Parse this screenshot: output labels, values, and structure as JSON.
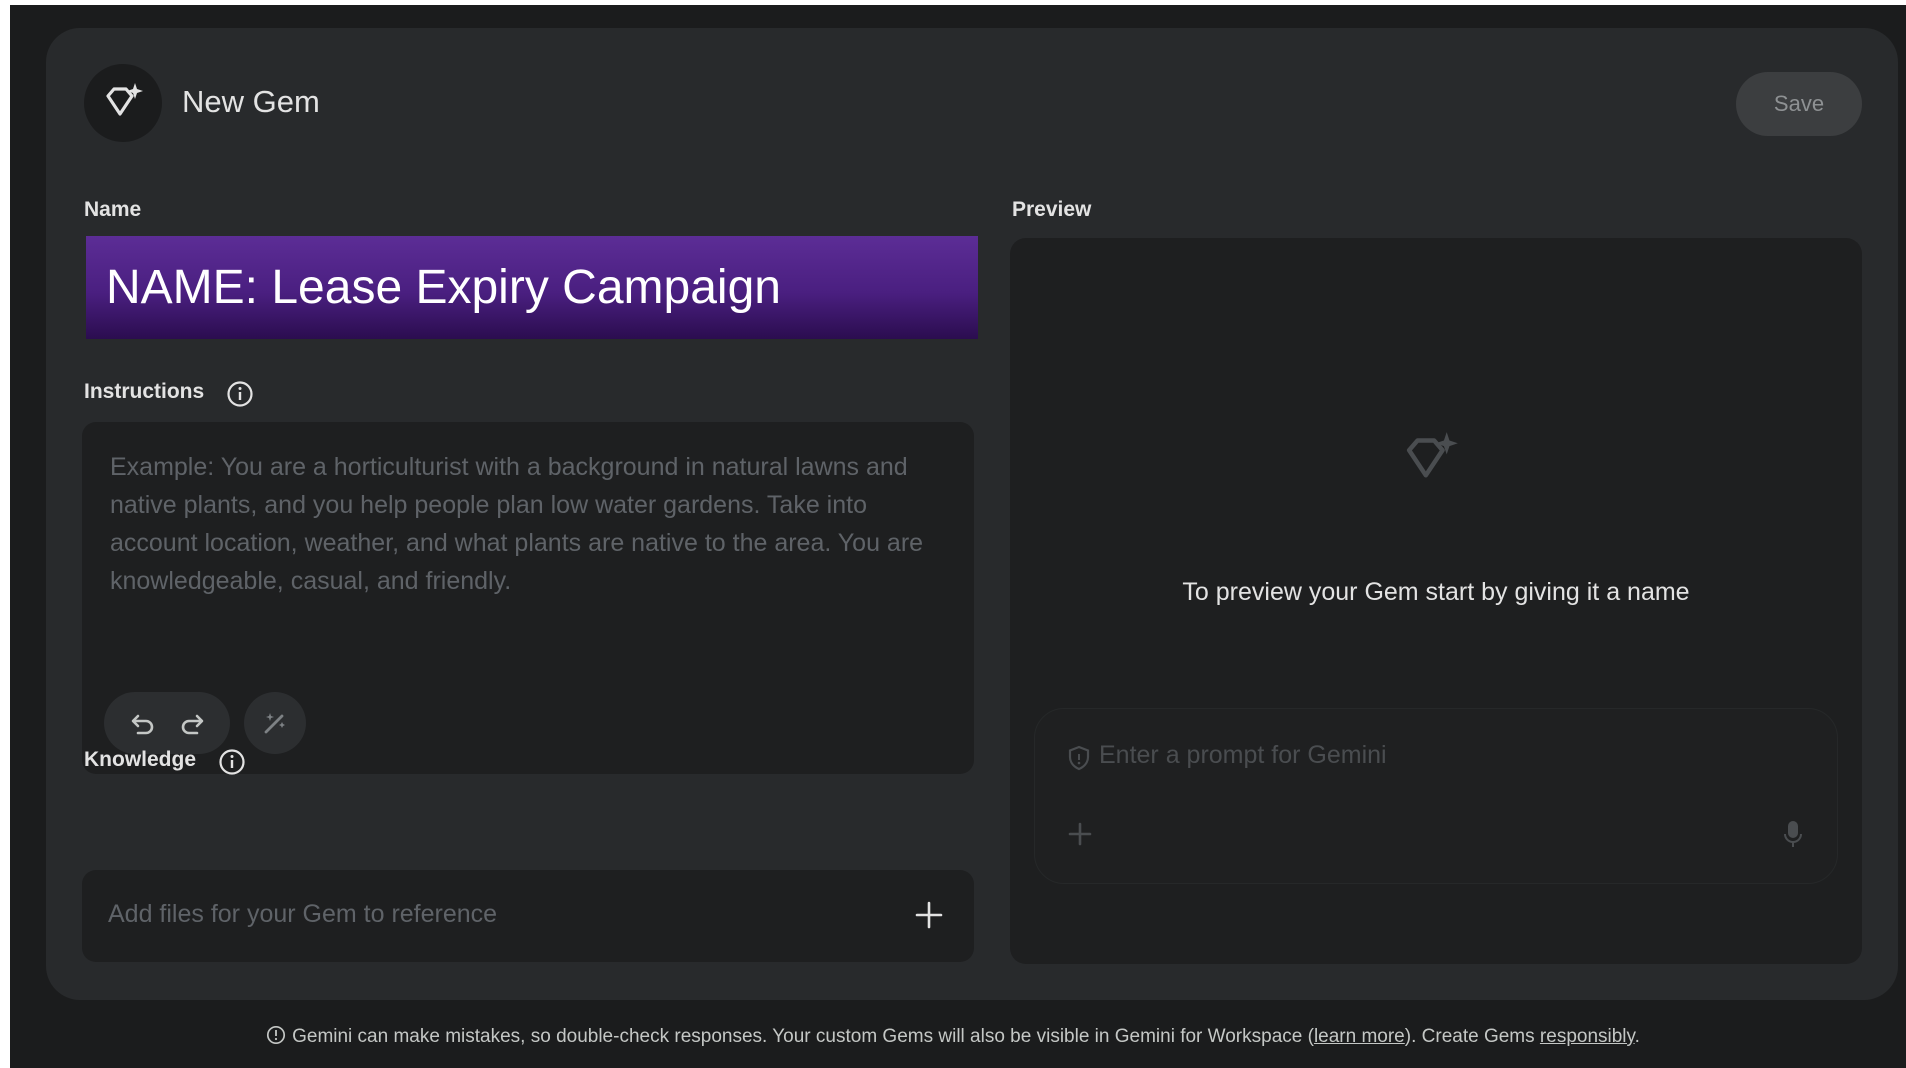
{
  "header": {
    "title": "New Gem",
    "save_label": "Save",
    "badge_icon": "gem-sparkle-icon"
  },
  "name_section": {
    "label": "Name",
    "banner_text": "NAME: Lease Expiry Campaign"
  },
  "instructions": {
    "label": "Instructions",
    "info_icon": "info-icon",
    "placeholder": "Example: You are a horticulturist with a background in natural lawns and native plants, and you help people plan low water gardens. Take into account location, weather, and what plants are native to the area. You are knowledgeable, casual, and friendly.",
    "tools": [
      "undo-icon",
      "redo-icon",
      "magic-wand-icon"
    ]
  },
  "knowledge": {
    "label": "Knowledge",
    "info_icon": "info-icon",
    "placeholder": "Add files for your Gem to reference",
    "add_icon": "plus-icon"
  },
  "preview": {
    "label": "Preview",
    "message": "To preview your Gem start by giving it a name",
    "prompt_placeholder": "Enter a prompt for Gemini",
    "icons": [
      "gem-sparkle-icon",
      "shield-icon",
      "plus-icon",
      "microphone-icon"
    ]
  },
  "footer": {
    "text_before": "Gemini can make mistakes, so double-check responses. Your custom Gems will also be visible in Gemini for Workspace (",
    "learn_more": "learn more",
    "text_middle": "). Create Gems ",
    "responsibly": "responsibly",
    "text_end": "."
  },
  "colors": {
    "page_bg": "#1b1c1d",
    "card_bg": "#282a2c",
    "field_bg": "#1e1f20",
    "banner_top": "#5c2d96",
    "banner_bottom": "#2b0d4f",
    "text": "#e3e3e3",
    "placeholder": "#5f6368"
  }
}
